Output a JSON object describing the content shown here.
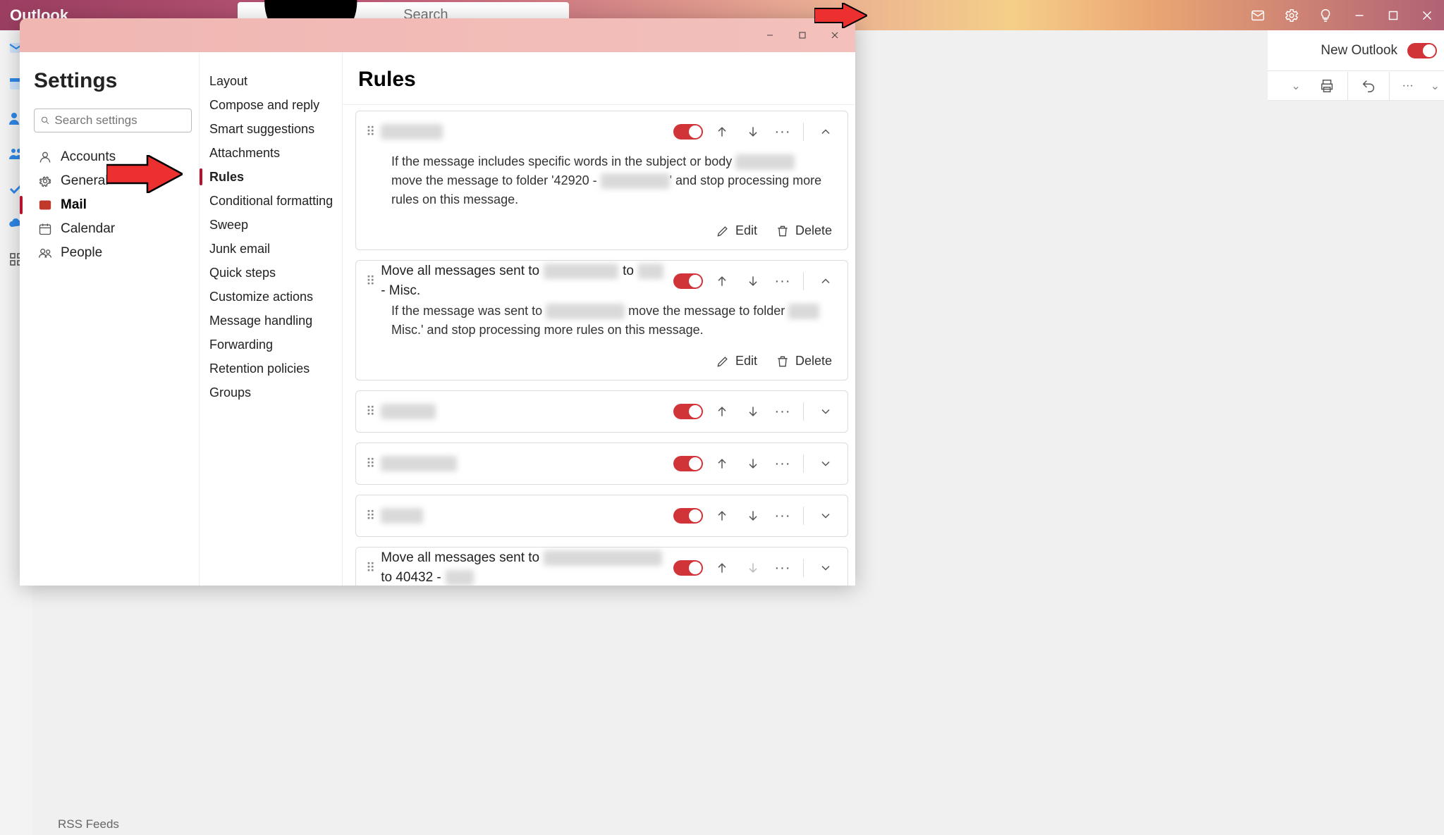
{
  "app": {
    "title": "Outlook",
    "search_placeholder": "Search",
    "new_outlook_label": "New Outlook"
  },
  "dialog": {
    "title": "Settings",
    "search_placeholder": "Search settings"
  },
  "nav1": [
    {
      "label": "Accounts",
      "icon": "person"
    },
    {
      "label": "General",
      "icon": "gear"
    },
    {
      "label": "Mail",
      "icon": "mail",
      "active": true
    },
    {
      "label": "Calendar",
      "icon": "calendar"
    },
    {
      "label": "People",
      "icon": "people"
    }
  ],
  "nav2": [
    "Layout",
    "Compose and reply",
    "Smart suggestions",
    "Attachments",
    "Rules",
    "Conditional formatting",
    "Sweep",
    "Junk email",
    "Quick steps",
    "Customize actions",
    "Message handling",
    "Forwarding",
    "Retention policies",
    "Groups"
  ],
  "nav2_active": "Rules",
  "panel": {
    "title": "Rules",
    "edit_label": "Edit",
    "delete_label": "Delete"
  },
  "rules": [
    {
      "title_parts": [
        ""
      ],
      "title_redactions": [
        88
      ],
      "expanded": true,
      "enabled": true,
      "up_disabled": false,
      "down_disabled": false,
      "body_pre": "If the message includes specific words in the subject or body ",
      "body_redaction1": 84,
      "body_mid": "move the message to folder '42920 - ",
      "body_redaction2": 98,
      "body_post": "' and stop processing more rules on this message."
    },
    {
      "title_parts": [
        "Move all messages sent to ",
        " to ",
        " - Misc."
      ],
      "title_redactions": [
        106,
        36
      ],
      "expanded": true,
      "enabled": true,
      "up_disabled": false,
      "down_disabled": false,
      "body_pre": "If the message was sent to ",
      "body_redaction1": 112,
      "body_mid": " move the message to folder ",
      "body_redaction2": 44,
      "body_post": " Misc.' and stop processing more rules on this message."
    },
    {
      "title_parts": [
        ""
      ],
      "title_redactions": [
        78
      ],
      "expanded": false,
      "enabled": true,
      "up_disabled": false,
      "down_disabled": false
    },
    {
      "title_parts": [
        ""
      ],
      "title_redactions": [
        108
      ],
      "expanded": false,
      "enabled": true,
      "up_disabled": false,
      "down_disabled": false
    },
    {
      "title_parts": [
        ""
      ],
      "title_redactions": [
        60
      ],
      "expanded": false,
      "enabled": true,
      "up_disabled": false,
      "down_disabled": false
    },
    {
      "title_parts": [
        "Move all messages sent to ",
        " to 40432 - "
      ],
      "title_redactions": [
        168,
        40
      ],
      "expanded": false,
      "enabled": true,
      "up_disabled": false,
      "down_disabled": true
    }
  ],
  "bg_peek": "RSS Feeds"
}
